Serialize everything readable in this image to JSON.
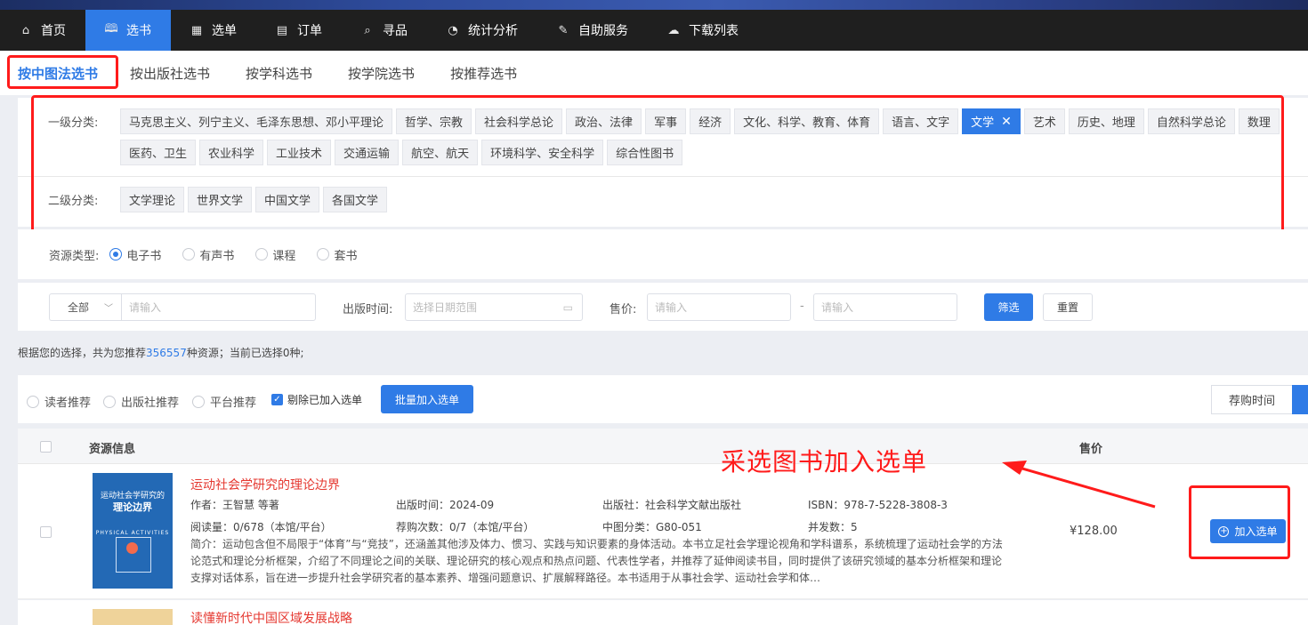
{
  "nav": [
    {
      "label": "首页",
      "icon": "home-icon",
      "glyph": "⌂",
      "active": false
    },
    {
      "label": "选书",
      "icon": "book-icon",
      "glyph": "🕮",
      "active": true
    },
    {
      "label": "选单",
      "icon": "grid-icon",
      "glyph": "▦",
      "active": false
    },
    {
      "label": "订单",
      "icon": "document-icon",
      "glyph": "▤",
      "active": false
    },
    {
      "label": "寻品",
      "icon": "search-icon",
      "glyph": "⌕",
      "active": false
    },
    {
      "label": "统计分析",
      "icon": "chart-clock-icon",
      "glyph": "◔",
      "active": false
    },
    {
      "label": "自助服务",
      "icon": "edit-icon",
      "glyph": "✎",
      "active": false
    },
    {
      "label": "下载列表",
      "icon": "cloud-download-icon",
      "glyph": "☁",
      "active": false
    }
  ],
  "subtabs": [
    "按中图法选书",
    "按出版社选书",
    "按学科选书",
    "按学院选书",
    "按推荐选书"
  ],
  "categories": {
    "level1_label": "一级分类:",
    "level1": [
      "马克思主义、列宁主义、毛泽东思想、邓小平理论",
      "哲学、宗教",
      "社会科学总论",
      "政治、法律",
      "军事",
      "经济",
      "文化、科学、教育、体育",
      "语言、文字",
      "文学",
      "艺术",
      "历史、地理",
      "自然科学总论",
      "数理"
    ],
    "level1_row2": [
      "医药、卫生",
      "农业科学",
      "工业技术",
      "交通运输",
      "航空、航天",
      "环境科学、安全科学",
      "综合性图书"
    ],
    "level1_selected": "文学",
    "level2_label": "二级分类:",
    "level2": [
      "文学理论",
      "世界文学",
      "中国文学",
      "各国文学"
    ]
  },
  "resource_type": {
    "label": "资源类型:",
    "options": [
      "电子书",
      "有声书",
      "课程",
      "套书"
    ],
    "selected": "电子书"
  },
  "filters": {
    "scope_value": "全部",
    "keyword_placeholder": "请输入",
    "pubtime_label": "出版时间:",
    "pubtime_placeholder": "选择日期范围",
    "price_label": "售价:",
    "price_min_placeholder": "请输入",
    "price_sep": "-",
    "price_max_placeholder": "请输入",
    "filter_btn": "筛选",
    "reset_btn": "重置"
  },
  "summary": {
    "prefix": "根据您的选择，共为您推荐",
    "count": "356557",
    "middle": "种资源；当前已选择",
    "selected": "0",
    "suffix": "种;"
  },
  "listbar": {
    "radios": [
      "读者推荐",
      "出版社推荐",
      "平台推荐"
    ],
    "exclude_label": "剔除已加入选单",
    "exclude_checked": true,
    "batch_btn": "批量加入选单",
    "sort_label": "荐购时间"
  },
  "table": {
    "col_info": "资源信息",
    "col_price": "售价"
  },
  "books": [
    {
      "title": "运动社会学研究的理论边界",
      "author": "作者：王智慧 等著",
      "pubtime": "出版时间：2024-09",
      "publisher": "出版社：社会科学文献出版社",
      "isbn": "ISBN：978-7-5228-3808-3",
      "reads": "阅读量：0/678（本馆/平台）",
      "recs": "荐购次数：0/7（本馆/平台）",
      "clc": "中图分类：G80-051",
      "concurrency": "并发数：5",
      "intro": "简介：运动包含但不局限于“体育”与“竞技”，还涵盖其他涉及体力、惯习、实践与知识要素的身体活动。本书立足社会学理论视角和学科谱系，系统梳理了运动社会学的方法论范式和理论分析框架，介绍了不同理论之间的关联、理论研究的核心观点和热点问题、代表性学者，并推荐了延伸阅读书目，同时提供了该研究领域的基本分析框架和理论支撑对话体系，旨在进一步提升社会学研究者的基本素养、增强问题意识、扩展解释路径。本书适用于从事社会学、运动社会学和体…",
      "price": "¥128.00",
      "add_btn": "加入选单",
      "cover_line1": "运动社会学研究的",
      "cover_line2": "理论边界",
      "cover_sub": "PHYSICAL ACTIVITIES"
    },
    {
      "title": "读懂新时代中国区域发展战略"
    }
  ],
  "annotation": "采选图书加入选单",
  "colors": {
    "accent": "#2f7be6",
    "highlight": "#ff1b1b",
    "title_red": "#e5372f"
  }
}
